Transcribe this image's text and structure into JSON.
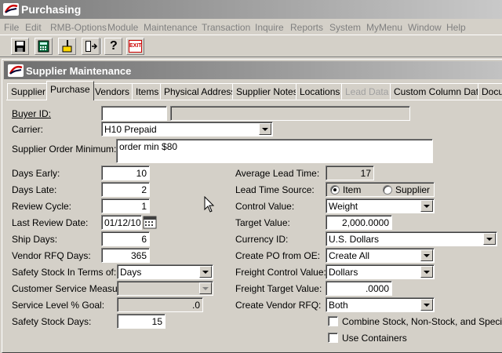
{
  "app": {
    "title": "Purchasing"
  },
  "menu": [
    "File",
    "Edit",
    "RMB-Options",
    "Module",
    "Maintenance",
    "Transaction",
    "Inquire",
    "Reports",
    "System",
    "MyMenu",
    "Window",
    "Help"
  ],
  "toolbar": {
    "icons": [
      "save-icon",
      "calculator-icon",
      "clear-icon",
      "exit-door-icon",
      "help-icon",
      "exit-icon"
    ],
    "exit_label": "EXIT",
    "help_label": "?"
  },
  "window": {
    "title": "Supplier Maintenance"
  },
  "tabs": [
    {
      "label": "Supplier",
      "state": "normal"
    },
    {
      "label": "Purchase",
      "state": "active"
    },
    {
      "label": "Vendors",
      "state": "normal"
    },
    {
      "label": "Items",
      "state": "normal"
    },
    {
      "label": "Physical Address",
      "state": "normal"
    },
    {
      "label": "Supplier Notes",
      "state": "normal"
    },
    {
      "label": "Locations",
      "state": "normal"
    },
    {
      "label": "Lead Data",
      "state": "disabled"
    },
    {
      "label": "Custom Column Data",
      "state": "normal"
    },
    {
      "label": "Docu",
      "state": "normal"
    }
  ],
  "form": {
    "buyer_id": {
      "label": "Buyer ID:",
      "value": "",
      "desc": ""
    },
    "carrier": {
      "label": "Carrier:",
      "value": "H10 Prepaid"
    },
    "order_minimum": {
      "label": "Supplier Order Minimum:",
      "value": "order min $80"
    },
    "days_early": {
      "label": "Days Early:",
      "value": "10"
    },
    "days_late": {
      "label": "Days Late:",
      "value": "2"
    },
    "review_cycle": {
      "label": "Review Cycle:",
      "value": "1"
    },
    "last_review_date": {
      "label": "Last Review Date:",
      "value": "01/12/10"
    },
    "ship_days": {
      "label": "Ship Days:",
      "value": "6"
    },
    "vendor_rfq_days": {
      "label": "Vendor RFQ Days:",
      "value": "365"
    },
    "safety_stock_terms": {
      "label": "Safety Stock In Terms of:",
      "value": "Days"
    },
    "customer_service_measure": {
      "label": "Customer Service Measure:",
      "value": ""
    },
    "service_level_goal": {
      "label": "Service Level % Goal:",
      "value": ".0"
    },
    "safety_stock_days": {
      "label": "Safety Stock Days:",
      "value": "15"
    },
    "average_lead_time": {
      "label": "Average Lead Time:",
      "value": "17"
    },
    "lead_time_source": {
      "label": "Lead Time Source:",
      "option_item": "Item",
      "option_supplier": "Supplier",
      "selected": "Item"
    },
    "control_value": {
      "label": "Control Value:",
      "value": "Weight"
    },
    "target_value": {
      "label": "Target Value:",
      "value": "2,000.0000"
    },
    "currency_id": {
      "label": "Currency ID:",
      "value": "U.S. Dollars"
    },
    "create_po_from_oe": {
      "label": "Create PO from OE:",
      "value": "Create All"
    },
    "freight_control_value": {
      "label": "Freight Control Value:",
      "value": "Dollars"
    },
    "freight_target_value": {
      "label": "Freight Target Value:",
      "value": ".0000"
    },
    "create_vendor_rfq": {
      "label": "Create Vendor RFQ:",
      "value": "Both"
    },
    "combine_stock": {
      "label": "Combine Stock, Non-Stock, and Special",
      "checked": false
    },
    "use_containers": {
      "label": "Use Containers",
      "checked": false
    }
  }
}
